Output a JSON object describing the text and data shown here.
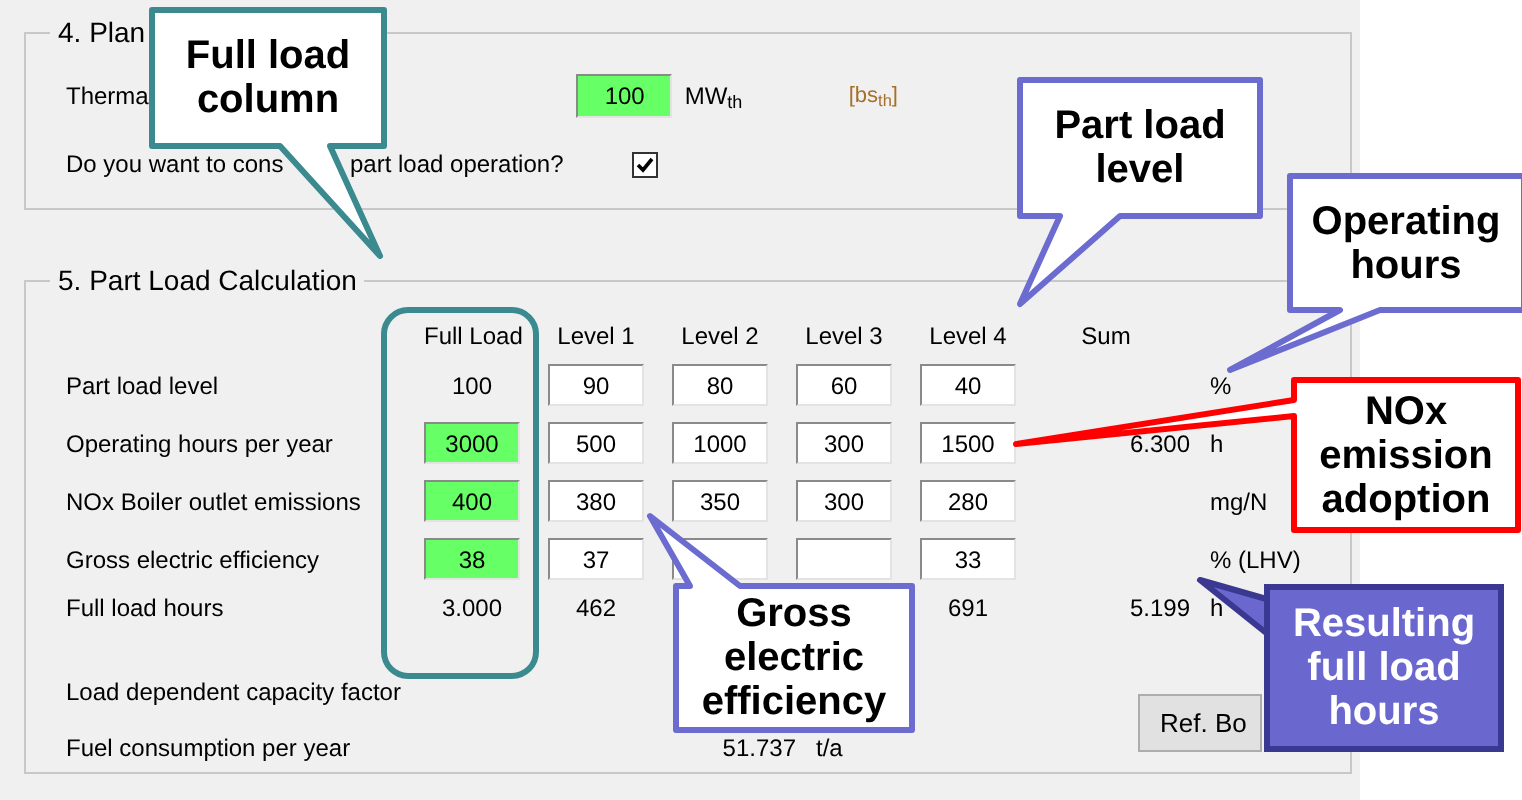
{
  "section4": {
    "title": "4. Plan",
    "thermal_label": "Therma",
    "thermal_value": "100",
    "thermal_unit": "MW$_{th}$",
    "thermal_note": "[bs$_{th}$]",
    "question_start": "Do you want to cons",
    "question_end": "part load operation?",
    "part_load_checked": true
  },
  "section5": {
    "title": "5. Part Load Calculation",
    "columns": [
      "Full Load",
      "Level 1",
      "Level 2",
      "Level 3",
      "Level 4",
      "Sum"
    ],
    "rows": [
      {
        "label": "Part load level",
        "cells": [
          {
            "kind": "plain",
            "value": "100"
          },
          {
            "kind": "field",
            "value": "90"
          },
          {
            "kind": "field",
            "value": "80"
          },
          {
            "kind": "field",
            "value": "60"
          },
          {
            "kind": "field",
            "value": "40"
          }
        ],
        "unit": "%"
      },
      {
        "label": "Operating hours per year",
        "cells": [
          {
            "kind": "required",
            "value": "3000"
          },
          {
            "kind": "field",
            "value": "500"
          },
          {
            "kind": "field",
            "value": "1000"
          },
          {
            "kind": "field",
            "value": "300"
          },
          {
            "kind": "field",
            "value": "1500"
          }
        ],
        "sum": "6.300",
        "unit": "h"
      },
      {
        "label": "NOx Boiler outlet emissions",
        "cells": [
          {
            "kind": "required",
            "value": "400"
          },
          {
            "kind": "field",
            "value": "380"
          },
          {
            "kind": "field",
            "value": "350"
          },
          {
            "kind": "field",
            "value": "300"
          },
          {
            "kind": "field",
            "value": "280"
          }
        ],
        "unit": "mg/N"
      },
      {
        "label": "Gross electric efficiency",
        "cells": [
          {
            "kind": "required",
            "value": "38"
          },
          {
            "kind": "field",
            "value": "37"
          },
          {
            "kind": "field"
          },
          {
            "kind": "field"
          },
          {
            "kind": "field",
            "value": "33"
          }
        ],
        "unit": "% (LHV)"
      },
      {
        "label": "Full load hours",
        "cells": [
          {
            "kind": "plain",
            "value": "3.000"
          },
          {
            "kind": "plain",
            "value": "462"
          },
          {
            "kind": "hidden"
          },
          {
            "kind": "hidden"
          },
          {
            "kind": "plain",
            "value": "691"
          }
        ],
        "sum": "5.199",
        "unit": "h"
      }
    ],
    "capacity_label": "Load dependent capacity factor",
    "fuel": {
      "label": "Fuel consumption per year",
      "value": "51.737",
      "unit": "t/a"
    },
    "ref_button": "Ref. Bo"
  },
  "callouts": [
    {
      "text": "Full load column"
    },
    {
      "text": "Part load level"
    },
    {
      "text": "Operating hours"
    },
    {
      "text": "NOx emission adoption"
    },
    {
      "text": "Gross electric efficiency"
    },
    {
      "text": "Resulting full load hours"
    }
  ]
}
